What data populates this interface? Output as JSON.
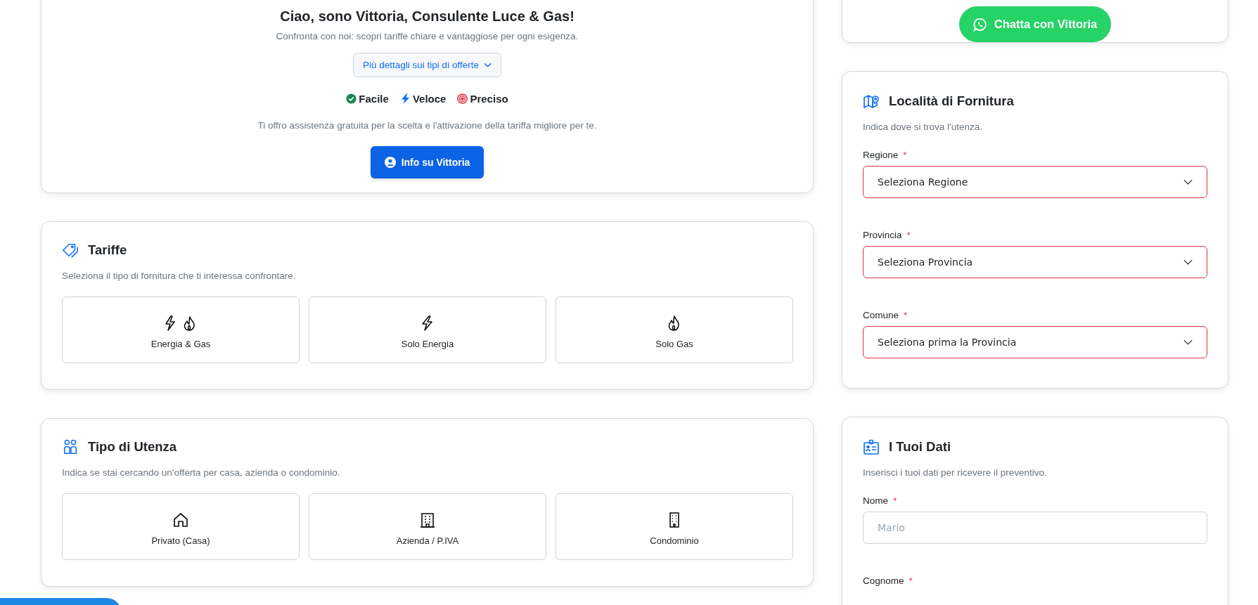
{
  "intro": {
    "title": "Ciao, sono Vittoria, Consulente Luce & Gas!",
    "subtitle": "Confronta con noi: scopri tariffe chiare e vantaggiose per ogni esigenza.",
    "details_button": "Più dettagli sui tipi di offerte",
    "features": [
      {
        "kind": "check",
        "label": "Facile"
      },
      {
        "kind": "bolt",
        "label": "Veloce"
      },
      {
        "kind": "target",
        "label": "Preciso"
      }
    ],
    "assistance": "Ti offro assistenza gratuita per la scelta e l'attivazione della tariffa migliore per te.",
    "info_button": "Info su Vittoria"
  },
  "tariffe": {
    "title": "Tariffe",
    "description": "Seleziona il tipo di fornitura che ti interessa confrontare.",
    "options": [
      {
        "kind": "energy_gas",
        "label": "Energia & Gas",
        "selected": false
      },
      {
        "kind": "energy",
        "label": "Solo Energia",
        "selected": false
      },
      {
        "kind": "gas",
        "label": "Solo Gas",
        "selected": false
      }
    ]
  },
  "utenza": {
    "title": "Tipo di Utenza",
    "description": "Indica se stai cercando un'offerta per casa, azienda o condominio.",
    "options": [
      {
        "kind": "house",
        "label": "Privato (Casa)",
        "selected": false
      },
      {
        "kind": "office",
        "label": "Azienda / P.IVA",
        "selected": false
      },
      {
        "kind": "condo",
        "label": "Condominio",
        "selected": false
      }
    ]
  },
  "chat_button": "Chatta con Vittoria",
  "localita": {
    "title": "Località di Fornitura",
    "description": "Indica dove si trova l'utenza.",
    "fields": [
      {
        "kind": "select",
        "label": "Regione",
        "required_mark": "*",
        "invalid": true,
        "value": "Seleziona Regione"
      },
      {
        "kind": "select",
        "label": "Provincia",
        "required_mark": "*",
        "invalid": true,
        "value": "Seleziona Provincia"
      },
      {
        "kind": "select",
        "label": "Comune",
        "required_mark": "*",
        "invalid": true,
        "value": "Seleziona prima la Provincia"
      }
    ]
  },
  "dati": {
    "title": "I Tuoi Dati",
    "description": "Inserisci i tuoi dati per ricevere il preventivo.",
    "fields": [
      {
        "kind": "text",
        "label": "Nome",
        "required_mark": "*",
        "invalid": false,
        "placeholder": "Mario"
      },
      {
        "kind": "label",
        "label": "Cognome",
        "required_mark": "*"
      }
    ]
  }
}
